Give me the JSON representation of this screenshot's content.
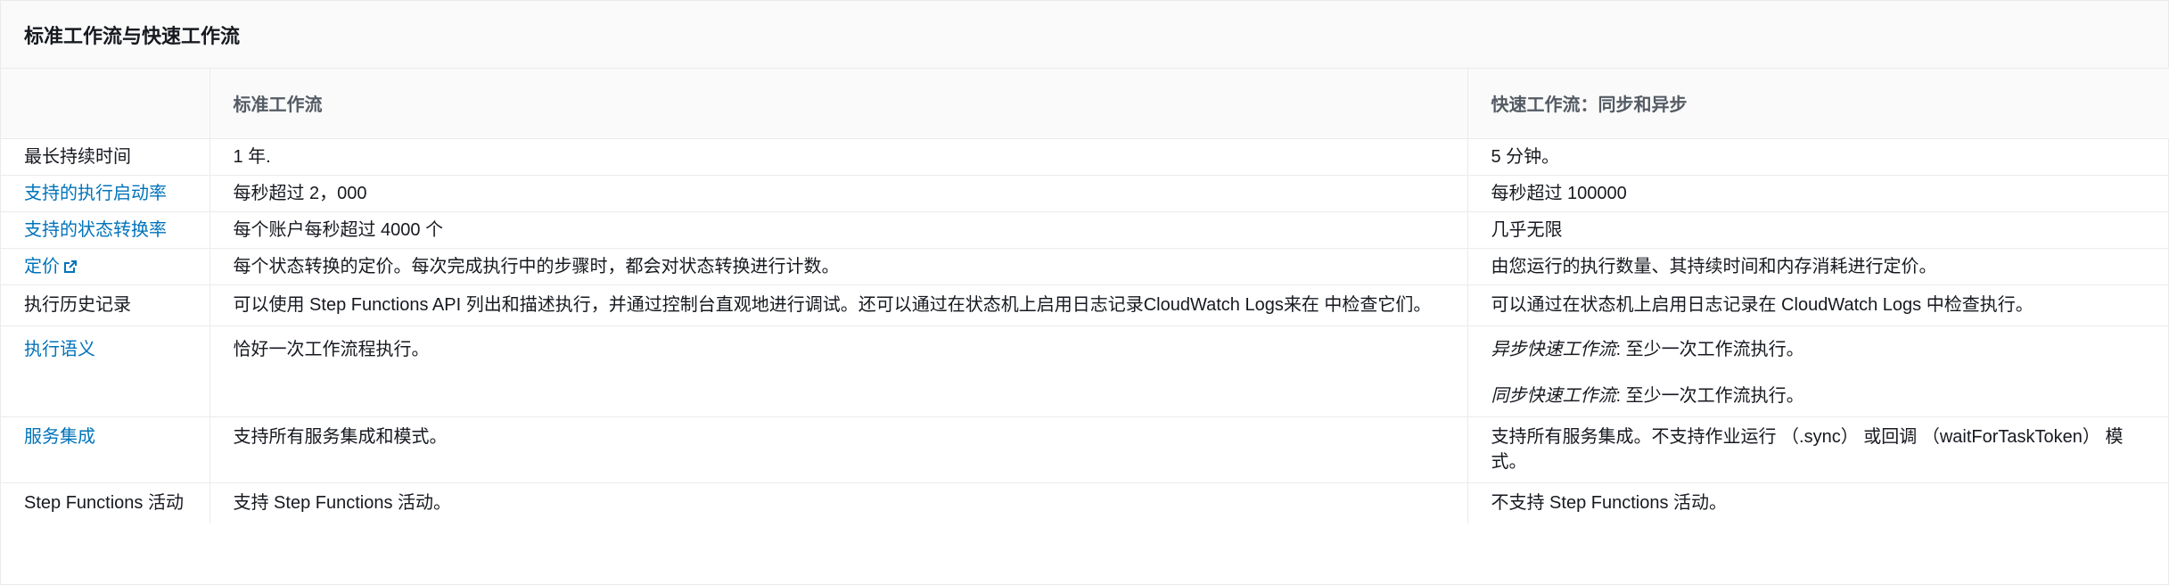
{
  "title": "标准工作流与快速工作流",
  "columns": [
    "",
    "标准工作流",
    "快速工作流：同步和异步"
  ],
  "rows": [
    {
      "label": "最长持续时间",
      "link": false,
      "standard": "1 年.",
      "express": "5 分钟。"
    },
    {
      "label": "支持的执行启动率",
      "link": true,
      "standard": "每秒超过 2，000",
      "express": "每秒超过 100000"
    },
    {
      "label": "支持的状态转换率",
      "link": true,
      "standard": "每个账户每秒超过 4000 个",
      "express": "几乎无限"
    },
    {
      "label": "定价",
      "link": true,
      "external": true,
      "standard": "每个状态转换的定价。每次完成执行中的步骤时，都会对状态转换进行计数。",
      "express": "由您运行的执行数量、其持续时间和内存消耗进行定价。"
    },
    {
      "label": "执行历史记录",
      "link": false,
      "standard": "可以使用 Step Functions API 列出和描述执行，并通过控制台直观地进行调试。还可以通过在状态机上启用日志记录CloudWatch Logs来在 中检查它们。",
      "express": "可以通过在状态机上启用日志记录在 CloudWatch Logs 中检查执行。"
    },
    {
      "label": "执行语义",
      "link": true,
      "standard": "恰好一次工作流程执行。",
      "express_parts": [
        {
          "em": "异步快速工作流",
          "text": ": 至少一次工作流执行。"
        },
        {
          "em": "同步快速工作流",
          "text": ": 至少一次工作流执行。"
        }
      ]
    },
    {
      "label": "服务集成",
      "link": true,
      "standard": "支持所有服务集成和模式。",
      "express": "支持所有服务集成。不支持作业运行 （.sync） 或回调 （waitForTaskToken） 模式。"
    },
    {
      "label": "Step Functions 活动",
      "link": false,
      "standard": "支持 Step Functions 活动。",
      "express": "不支持 Step Functions 活动。"
    }
  ],
  "colors": {
    "link": "#0073bb",
    "header_bg": "#fafafa",
    "border": "#e9ebed"
  },
  "icons": {
    "external_link": "external-link-icon"
  }
}
